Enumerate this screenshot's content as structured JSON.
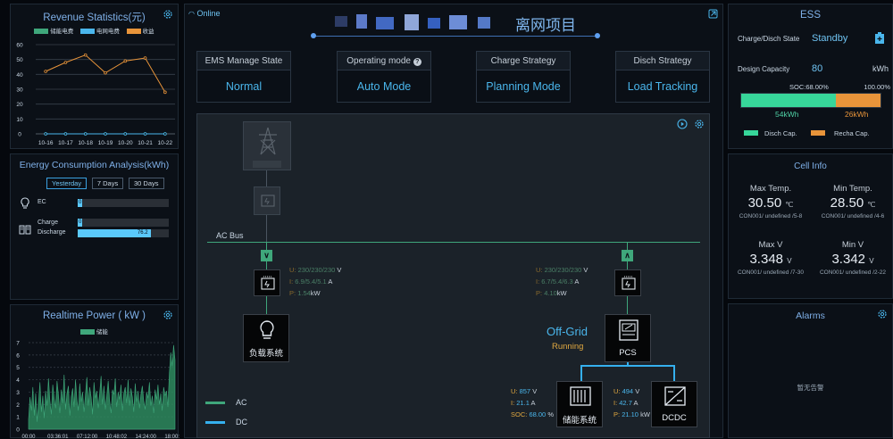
{
  "revenue": {
    "title": "Revenue Statistics(元)",
    "legend": [
      {
        "label": "储能电费",
        "color": "#3fa77b"
      },
      {
        "label": "电网电费",
        "color": "#4ab6ec"
      },
      {
        "label": "收益",
        "color": "#e8943a"
      }
    ],
    "y_ticks": [
      "60",
      "50",
      "40",
      "30",
      "20",
      "10",
      "0"
    ],
    "x_ticks": [
      "10-16",
      "10-17",
      "10-18",
      "10-19",
      "10-20",
      "10-21",
      "10-22"
    ]
  },
  "chart_data": [
    {
      "type": "line",
      "title": "Revenue Statistics(元)",
      "categories": [
        "10-16",
        "10-17",
        "10-18",
        "10-19",
        "10-20",
        "10-21",
        "10-22"
      ],
      "series": [
        {
          "name": "储能电费",
          "values": [
            0,
            0,
            0,
            0,
            0,
            0,
            0
          ]
        },
        {
          "name": "电网电费",
          "values": [
            0,
            0,
            0,
            0,
            0,
            0,
            0
          ]
        },
        {
          "name": "收益",
          "values": [
            42,
            48,
            53,
            41,
            49,
            51,
            28
          ]
        }
      ],
      "ylim": [
        0,
        60
      ]
    },
    {
      "type": "line",
      "title": "Realtime Power ( kW )",
      "series": [
        {
          "name": "储能",
          "values": [
            0.8,
            2.6,
            1.5,
            3.4,
            1.1,
            2.9,
            0.6,
            2.2,
            3.8,
            1.4,
            2.7,
            0.9,
            3.1,
            1.9,
            4.1,
            2.3,
            1.2,
            3.6,
            2.5,
            1.7,
            3.9,
            2.8,
            1.3,
            3.2,
            2.1,
            4.4,
            1.6,
            2.9,
            3.5,
            1.1,
            2.6,
            3.3,
            1.8,
            4.0,
            2.4,
            1.5,
            3.7,
            2.2,
            3.0,
            1.4,
            2.8,
            4.2,
            1.9,
            3.4,
            2.6,
            1.2,
            3.8,
            2.5,
            3.1,
            1.7,
            2.9,
            4.3,
            2.0,
            3.5,
            1.6,
            2.7,
            3.9,
            2.3,
            1.3,
            3.2,
            2.8,
            4.1,
            1.8,
            3.0,
            2.4,
            3.6,
            1.5,
            2.9,
            3.4,
            2.1,
            4.0,
            1.9,
            3.3,
            2.6,
            1.4,
            3.7,
            2.2,
            3.1,
            1.7,
            2.8,
            3.5,
            2.3,
            1.6,
            3.0,
            2.5,
            3.8,
            1.9,
            2.7,
            1.3,
            3.2,
            2.4,
            3.6,
            2.0,
            2.9,
            1.5,
            3.4,
            2.7,
            3.1,
            1.8,
            4.5,
            6.2,
            5.1,
            6.8,
            5.6
          ]
        }
      ],
      "x_ticks": [
        "00:00",
        "03:36:01",
        "07:12:00",
        "10:48:02",
        "14:24:00",
        "18:00:00"
      ],
      "y_ticks": [
        "7",
        "6",
        "5",
        "4",
        "3",
        "2",
        "1",
        "0"
      ],
      "ylim": [
        0,
        7
      ]
    }
  ],
  "energy": {
    "title": "Energy Consumption Analysis(kWh)",
    "tabs": [
      "Yesterday",
      "7 Days",
      "30 Days"
    ],
    "ec_label": "EC",
    "ec_value": "0",
    "charge_label": "Charge",
    "charge_value": "0",
    "discharge_label": "Discharge",
    "discharge_value": "76.2",
    "discharge_fraction": 0.8
  },
  "realtime": {
    "title": "Realtime Power ( kW )",
    "legend": "储能"
  },
  "header": {
    "status": "Online",
    "project": "离网项目"
  },
  "boxes": [
    {
      "title": "EMS Manage State",
      "value": "Normal"
    },
    {
      "title": "Operating mode",
      "value": "Auto Mode"
    },
    {
      "title": "Charge Strategy",
      "value": "Planning Mode"
    },
    {
      "title": "Disch Strategy",
      "value": "Load Tracking"
    }
  ],
  "diagram": {
    "ac_bus": "AC Bus",
    "left_meter": {
      "u_label": "U:",
      "u": "230/230/230",
      "u_unit": "V",
      "i_label": "I:",
      "i": "6.9/5.4/5.1",
      "i_unit": "A",
      "p_label": "P:",
      "p": "1.54",
      "p_unit": "kW"
    },
    "right_meter": {
      "u_label": "U:",
      "u": "230/230/230",
      "u_unit": "V",
      "i_label": "I:",
      "i": "6.7/5.4/6.3",
      "i_unit": "A",
      "p_label": "P:",
      "p": "4.10",
      "p_unit": "kW"
    },
    "load_label": "负载系统",
    "offgrid": "Off-Grid",
    "running": "Running",
    "pcs_label": "PCS",
    "storage_label": "储能系统",
    "dcdc_label": "DCDC",
    "storage_vals": {
      "u_label": "U:",
      "u": "857",
      "u_unit": "V",
      "i_label": "I:",
      "i": "21.1",
      "i_unit": "A",
      "soc_label": "SOC:",
      "soc": "68.00",
      "soc_unit": "%"
    },
    "dcdc_vals": {
      "u_label": "U:",
      "u": "494",
      "u_unit": "V",
      "i_label": "I:",
      "i": "42.7",
      "i_unit": "A",
      "p_label": "P:",
      "p": "21.10",
      "p_unit": "kW"
    },
    "legend_ac": "AC",
    "legend_dc": "DC",
    "color_ac": "#3fa77b",
    "color_dc": "#35b0ee"
  },
  "ess": {
    "title": "ESS",
    "state_label": "Charge/Disch State",
    "state_value": "Standby",
    "cap_label": "Design Capacity",
    "cap_value": "80",
    "cap_unit": "kWh",
    "soc_label": "SOC:68.00%",
    "full_label": "100.00%",
    "soc_fraction": 0.68,
    "disch_value": "54kWh",
    "recha_value": "26kWh",
    "legend_disch": "Disch Cap.",
    "legend_recha": "Recha Cap."
  },
  "cell": {
    "title": "Cell Info",
    "items": [
      {
        "label": "Max Temp.",
        "value": "30.50",
        "unit": "℃",
        "sub": "CON001/ undefined /5-8"
      },
      {
        "label": "Min Temp.",
        "value": "28.50",
        "unit": "℃",
        "sub": "CON001/ undefined /4-6"
      },
      {
        "label": "Max V",
        "value": "3.348",
        "unit": "V",
        "sub": "CON001/ undefined /7-30"
      },
      {
        "label": "Min V",
        "value": "3.342",
        "unit": "V",
        "sub": "CON001/ undefined /2-22"
      }
    ]
  },
  "alarms": {
    "title": "Alarms",
    "empty": "暂无告警"
  }
}
